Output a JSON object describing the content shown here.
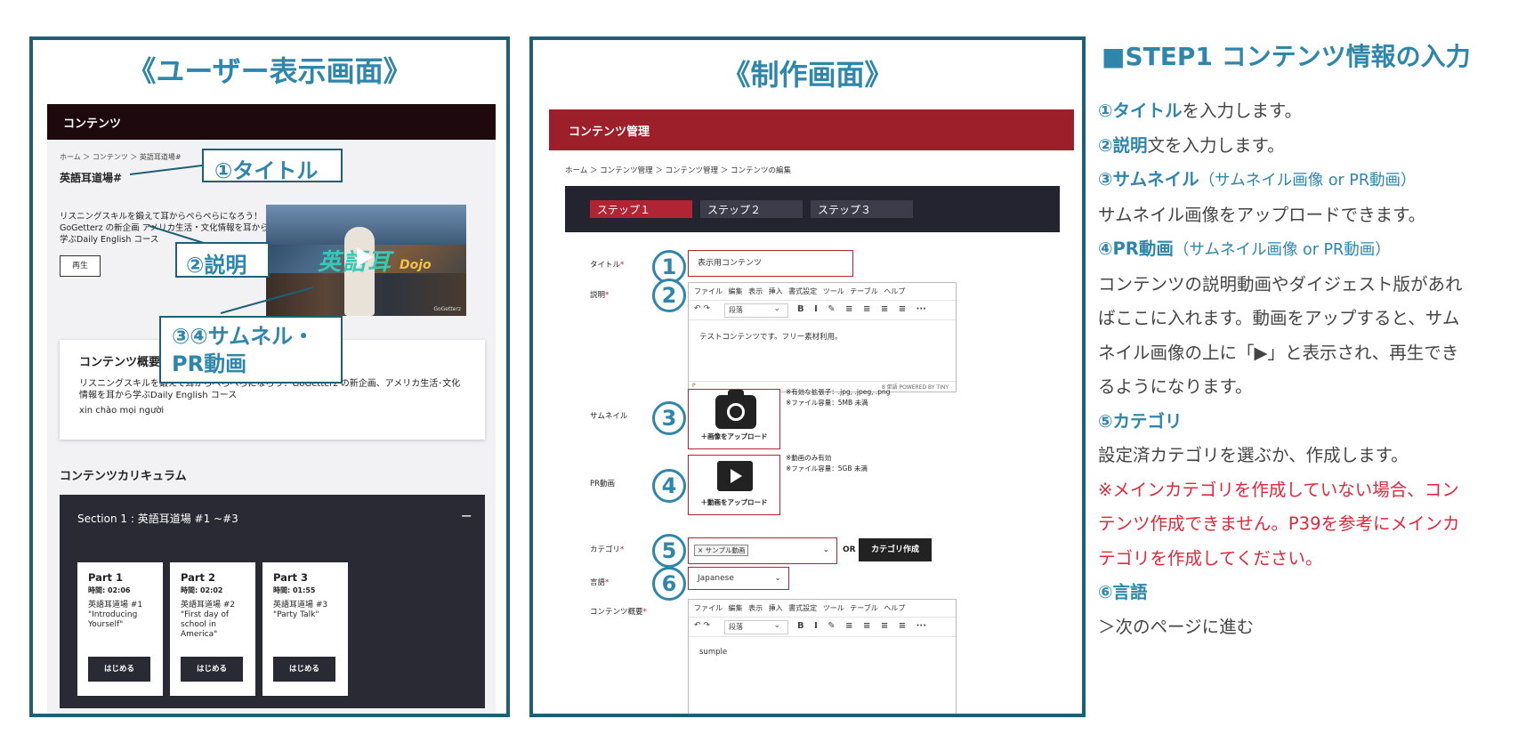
{
  "left_panel": {
    "title": "《ユーザー表示画面》",
    "header": "コンテンツ",
    "breadcrumb": "ホーム ＞ コンテンツ ＞ 英語耳道場#",
    "content_title": "英語耳道場#",
    "description": "リスニングスキルを鍛えて耳からぺらぺらになろう！GoGetterz の新企画 アメリカ生活・文化情報を耳から学ぶDaily English コース",
    "play_button": "再生",
    "thumb_logo": "英語耳",
    "thumb_logo2": "Dojo",
    "thumb_mark": "GoGetterz",
    "summary_card": {
      "heading": "コンテンツ概要",
      "text": "リスニングスキルを鍛えて耳からぺらぺらになろう！GoGetterz の新企画、アメリカ生活･文化情報を耳から学ぶDaily English コース",
      "greeting": "xin chào mọi người"
    },
    "curriculum_title": "コンテンツカリキュラム",
    "section": {
      "title": "Section 1 : 英語耳道場 #1 ~#3",
      "toggle": "−",
      "parts": [
        {
          "name": "Part 1",
          "time": "時間: 02:06",
          "desc": "英語耳道場 #1 \"Introducing Yourself\"",
          "button": "はじめる"
        },
        {
          "name": "Part 2",
          "time": "時間: 02:02",
          "desc": "英語耳道場 #2 \"First day of school in America\"",
          "button": "はじめる"
        },
        {
          "name": "Part 3",
          "time": "時間: 01:55",
          "desc": "英語耳道場 #3 \"Party Talk\"",
          "button": "はじめる"
        }
      ]
    },
    "callouts": {
      "title": "①タイトル",
      "description": "②説明",
      "thumbnail_line1": "③④サムネル・",
      "thumbnail_line2": "PR動画"
    }
  },
  "center_panel": {
    "title": "《制作画面》",
    "header": "コンテンツ管理",
    "breadcrumb": "ホーム ＞ コンテンツ管理 ＞ コンテンツ管理 ＞ コンテンツの編集",
    "steps": [
      "ステップ１",
      "ステップ２",
      "ステップ３"
    ],
    "labels": {
      "title": "タイトル",
      "description": "説明",
      "thumbnail": "サムネイル",
      "pr_video": "PR動画",
      "category": "カテゴリ",
      "language": "言語",
      "summary": "コンテンツ概要"
    },
    "required_mark": "*",
    "numbers": [
      "1",
      "2",
      "3",
      "4",
      "5",
      "6"
    ],
    "title_value": "表示用コンテンツ",
    "editor_menu": "ファイル 編集 表示 挿入 書式設定 ツール テーブル ヘルプ",
    "editor_tools": "↶ ↷",
    "editor_paragraph": "段落",
    "editor_format": "B I ✎ ≡ ≡ ≡ ≡ ···",
    "description_value": "テストコンテンツです。フリー素材利用。",
    "editor_footer_left": "P",
    "editor_footer_right": "8 単語  POWERED BY TINY",
    "thumbnail_upload": "＋画像をアップロード",
    "thumbnail_note1": "※有効な拡張子：.jpg, .jpeg, .png",
    "thumbnail_note2": "※ファイル容量：5MB 未満",
    "video_upload": "＋動画をアップロード",
    "video_note1": "※動画のみ有効",
    "video_note2": "※ファイル容量：5GB 未満",
    "category_tag": "× サンプル動画",
    "or": "OR",
    "create_category": "カテゴリ作成",
    "language_value": "Japanese",
    "summary_value": "sumple"
  },
  "right_panel": {
    "heading": "■STEP1 コンテンツ情報の入力",
    "item1_kw": "①タイトル",
    "item1_rest": "を入力します。",
    "item2_kw": "②説明",
    "item2_rest": "文を入力します。",
    "item3_kw": "③サムネイル",
    "item3_sub": "（サムネイル画像 or PR動画）",
    "item3_text": "サムネイル画像をアップロードできます。",
    "item4_kw": "④PR動画",
    "item4_sub": "（サムネイル画像 or PR動画）",
    "item4_text": [
      "コンテンツの説明動画やダイジェスト版があれ",
      "ばここに入れます。動画をアップすると、サム",
      "ネイル画像の上に「▶」と表示され、再生でき",
      "るようになります。"
    ],
    "item5_kw": "⑤カテゴリ",
    "item5_text": "設定済カテゴリを選ぶか、作成します。",
    "warning": [
      "※メインカテゴリを作成していない場合、コン",
      "テンツ作成できません。P39を参考にメインカ",
      "テゴリを作成してください。"
    ],
    "item6_kw": "⑥言語",
    "next": "＞次のページに進む"
  },
  "colors": {
    "accent_blue": "#2e86ab",
    "frame": "#1f5f76",
    "admin_red": "#9c1f2a",
    "warning_red": "#e0283c"
  }
}
